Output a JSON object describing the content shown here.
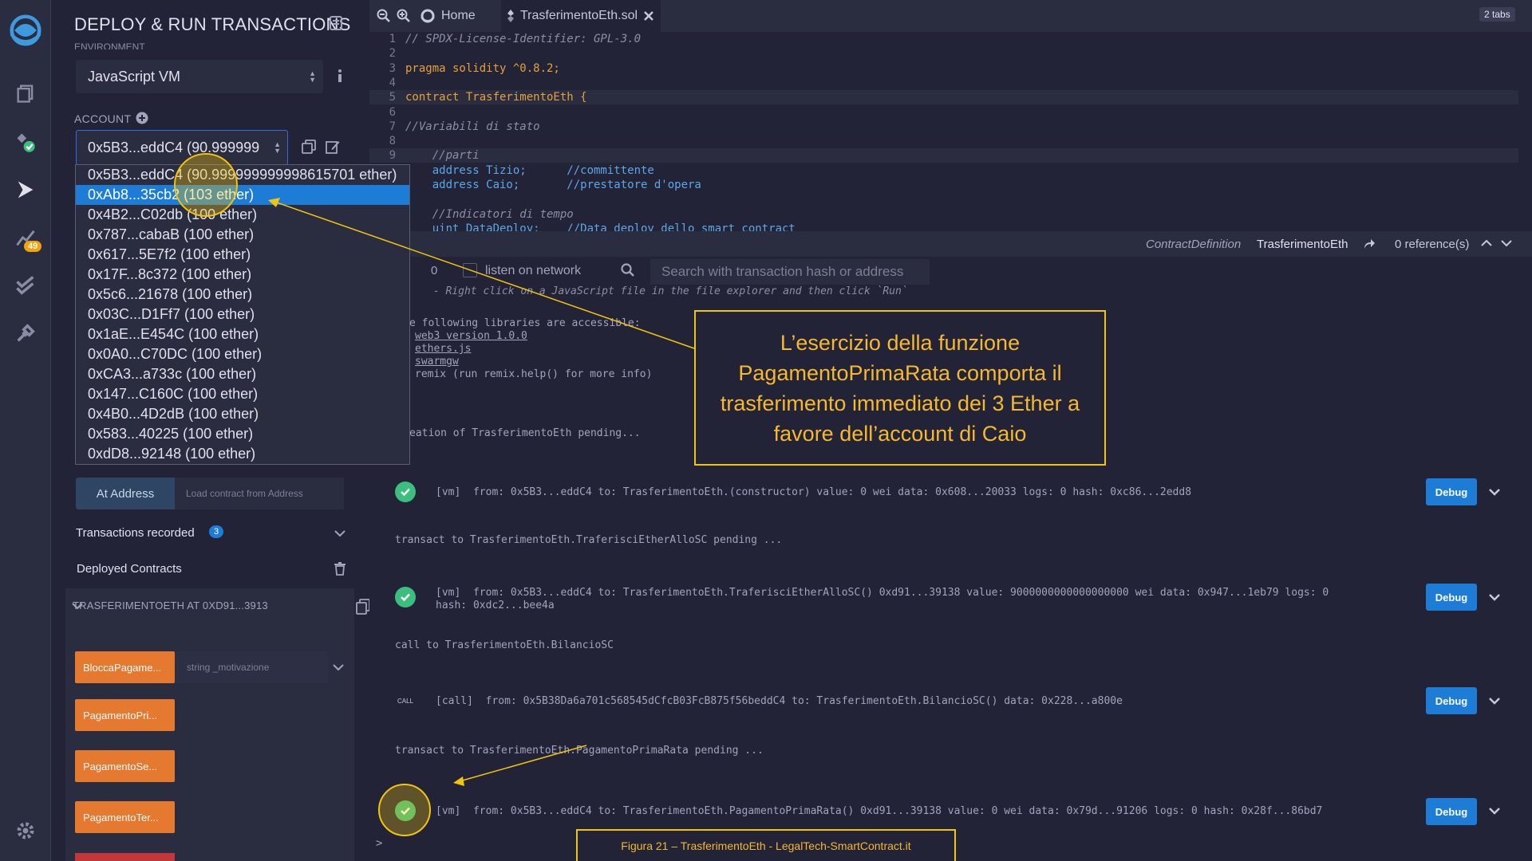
{
  "side_panel": {
    "title": "DEPLOY & RUN TRANSACTIONS",
    "environment_label": "ENVIRONMENT",
    "environment_value": "JavaScript VM",
    "account_label": "ACCOUNT",
    "account_value": "0x5B3...eddC4 (90.999999",
    "account_options": [
      "0x5B3...eddC4 (90.999999999998615701 ether)",
      "0xAb8...35cb2 (103 ether)",
      "0x4B2...C02db (100 ether)",
      "0x787...cabaB (100 ether)",
      "0x617...5E7f2 (100 ether)",
      "0x17F...8c372 (100 ether)",
      "0x5c6...21678 (100 ether)",
      "0x03C...D1Ff7 (100 ether)",
      "0x1aE...E454C (100 ether)",
      "0x0A0...C70DC (100 ether)",
      "0xCA3...a733c (100 ether)",
      "0x147...C160C (100 ether)",
      "0x4B0...4D2dB (100 ether)",
      "0x583...40225 (100 ether)",
      "0xdD8...92148 (100 ether)"
    ],
    "selected_option_index": 1,
    "at_address_button": "At Address",
    "at_address_placeholder": "Load contract from Address",
    "transactions_recorded_label": "Transactions recorded",
    "transactions_recorded_count": "3",
    "deployed_contracts_label": "Deployed Contracts",
    "contract_instance": "TRASFERIMENTOETH AT 0XD91...3913",
    "functions": [
      {
        "label": "BloccaPagame...",
        "input_placeholder": "string _motivazione"
      },
      {
        "label": "PagamentoPri..."
      },
      {
        "label": "PagamentoSe..."
      },
      {
        "label": "PagamentoTer..."
      }
    ]
  },
  "rail": {
    "badge_count": "49",
    "icons": [
      "remix-logo-icon",
      "file-explorer-icon",
      "compiler-icon",
      "deploy-icon",
      "analysis-icon",
      "test-icon",
      "plugin-icon",
      "settings-icon"
    ]
  },
  "tabs": {
    "home_label": "Home",
    "file_label": "TrasferimentoEth.sol",
    "count_label": "2 tabs"
  },
  "code_lines": [
    {
      "n": "1",
      "t": "// SPDX-License-Identifier: GPL-3.0"
    },
    {
      "n": "2",
      "t": ""
    },
    {
      "n": "3",
      "t": "pragma solidity ^0.8.2;"
    },
    {
      "n": "4",
      "t": ""
    },
    {
      "n": "5",
      "t": "contract TrasferimentoEth {"
    },
    {
      "n": "6",
      "t": ""
    },
    {
      "n": "7",
      "t": "//Variabili di stato"
    },
    {
      "n": "8",
      "t": ""
    },
    {
      "n": "9",
      "t": "    //parti"
    },
    {
      "n": "",
      "t": "    address Tizio;      //committente"
    },
    {
      "n": "",
      "t": "    address Caio;       //prestatore d'opera"
    },
    {
      "n": "",
      "t": ""
    },
    {
      "n": "",
      "t": "    //Indicatori di tempo"
    },
    {
      "n": "",
      "t": "    uint DataDeploy;    //Data deploy dello smart contract"
    }
  ],
  "definition_bar": {
    "kind": "ContractDefinition",
    "name": "TrasferimentoEth",
    "refs": "0 reference(s)"
  },
  "terminal_bar": {
    "pending_count": "0",
    "listen_label": "listen on network",
    "search_placeholder": "Search with transaction hash or address"
  },
  "terminal": {
    "line_run": " - Right click on a JavaScript file in the file explorer and then click `Run`",
    "line_libs": "e following libraries are accessible:",
    "lib_web3": "web3 version 1.0.0",
    "lib_ethers": "ethers.js",
    "lib_swarm": "swarmgw",
    "lib_remix": "remix (run remix.help() for more info)",
    "line_creation": "eation of TrasferimentoEth pending...",
    "tx1": "[vm]  from: 0x5B3...eddC4 to: TrasferimentoEth.(constructor) value: 0 wei data: 0x608...20033 logs: 0 hash: 0xc86...2edd8",
    "pending2": "transact to TrasferimentoEth.TraferisciEtherAlloSC pending ...",
    "tx2a": "[vm]  from: 0x5B3...eddC4 to: TrasferimentoEth.TraferisciEtherAlloSC() 0xd91...39138 value: 9000000000000000000 wei data: 0x947...1eb79 logs: 0",
    "tx2b": "hash: 0xdc2...bee4a",
    "call_line": "call to TrasferimentoEth.BilancioSC",
    "call_tag": "CALL",
    "tx3": "[call]  from: 0x5B38Da6a701c568545dCfcB03FcB875f56beddC4 to: TrasferimentoEth.BilancioSC() data: 0x228...a800e",
    "pending4": "transact to TrasferimentoEth.PagamentoPrimaRata pending ...",
    "tx4": "[vm]  from: 0x5B3...eddC4 to: TrasferimentoEth.PagamentoPrimaRata() 0xd91...39138 value: 0 wei data: 0x79d...91206 logs: 0 hash: 0x28f...86bd7",
    "debug_label": "Debug",
    "prompt": ">"
  },
  "annotation": {
    "callout": "L’esercizio della funzione PagamentoPrimaRata comporta il trasferimento immediato dei 3 Ether a favore dell’account di Caio",
    "caption": "Figura 21 – TrasferimentoEth - LegalTech-SmartContract.it",
    "color": "#f1c40f"
  },
  "colors": {
    "accent_blue": "#1c7cd6",
    "function_orange": "#e5792f",
    "success_green": "#3cbf7e",
    "background": "#222336"
  }
}
